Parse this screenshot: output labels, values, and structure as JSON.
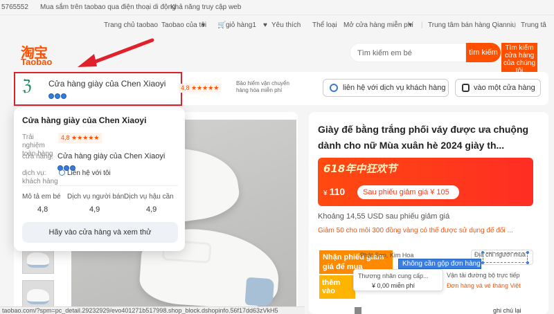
{
  "topbar": {
    "left_text": "5765552",
    "mobile_link": "Mua sắm trên taobao qua điện thoại di động",
    "accessibility": "Khả năng truy cập web"
  },
  "nav": {
    "home": "Trang chủ taobao",
    "my_taobao": "Taobao của tôi",
    "cart": "giỏ hàng1",
    "favorites": "Yêu thích",
    "categories": "Thể loại",
    "open_store": "Mở cửa hàng miễn phí",
    "seller_center": "Trung tâm bán hàng Qianniu",
    "center": "Trung tâ"
  },
  "logo": {
    "cn": "淘宝",
    "en": "Taobao"
  },
  "search": {
    "placeholder": "Tìm kiếm em bé",
    "button": "tìm kiếm",
    "side": "Tìm kiếm cửa hàng của chúng tôi"
  },
  "shop": {
    "name": "Cửa hàng giày của Chen Xiaoyi",
    "rating": "4,8 ★★★★★",
    "insurance": "Bảo hiểm vận chuyển hàng hóa miễn phí",
    "contact_button": "liên hệ với dịch vụ khách hàng",
    "enter_button": "vào một cửa hàng"
  },
  "popup": {
    "title": "Cửa hàng giày của Chen Xiaoyi",
    "rating_label": "Trải nghiệm toàn hàng",
    "rating": "4,8 ★★★★★",
    "shop_label": "cửa hàng:",
    "shop_value": "Cửa hàng giày của Chen Xiaoyi",
    "service_label": "dịch vụ: khách hàng",
    "contact": "Liên hệ với tôi",
    "metrics": [
      {
        "label": "Mô tả em bé",
        "value": "4,8"
      },
      {
        "label": "Dịch vụ người bán",
        "value": "4,9"
      },
      {
        "label": "Dịch vụ hậu cần",
        "value": "4,9"
      }
    ],
    "visit_button": "Hãy vào cửa hàng và xem thử"
  },
  "product": {
    "title": "Giày đế bằng trắng phối váy được ưa chuộng dành cho nữ Mùa xuân hè 2024 giày th...",
    "promo_head": "618年中狂欢节",
    "price_symbol": "¥",
    "price": "110",
    "coupon": "Sau phiếu giảm giá ¥ 105",
    "usd_note": "Khoảng 14,55 USD sau phiếu giảm giá",
    "discount_note": "Giảm 50 cho mỗi 300 đồng vàng có thể được sử dụng để đổi ..."
  },
  "shipping": {
    "tag1": "Nhận phiếu giảm giá để mua",
    "tag2": "thêm vào",
    "origin": "Phật Sơn, Kim Hoa",
    "address_btn": "Địa chỉ người mua",
    "merge_label": "Không cần gộp đơn hàng",
    "addr_popup_line1": "Thương nhân cung cấp...",
    "addr_popup_line2": "¥ 0,00 miễn phí",
    "transport": "Vận tải đường bộ trực tiếp",
    "vn_orders": "Đơn hàng và vé tháng Việt",
    "tail": "ghi chú lại"
  },
  "status_url": "taobao.com/?spm=pc_detail.29232929/evo401271b517998.shop_block.dshopinfo.56f17dd63zVkH5"
}
